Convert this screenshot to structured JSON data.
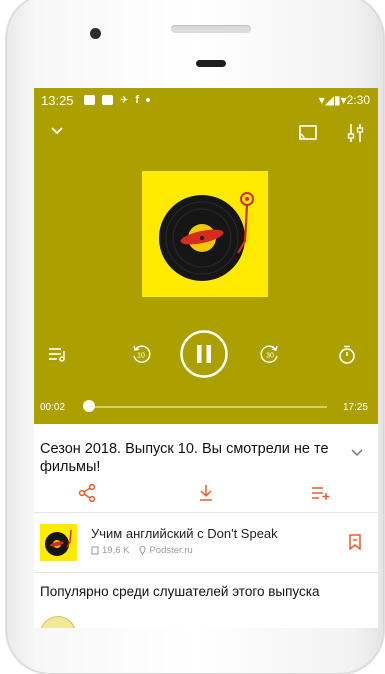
{
  "status_bar": {
    "time": "13:25",
    "fb": "f",
    "right": "▾◢▮▾2:30"
  },
  "player": {
    "elapsed": "00:02",
    "total": "17:25",
    "progress": 0.02,
    "background": "#aca000",
    "cover_text": "Don't Speak"
  },
  "episode": {
    "title": "Сезон 2018. Выпуск 10. Вы смотрели не те фильмы!"
  },
  "podcast": {
    "name": "Учим английский с Don't Speak",
    "listens": "19,6 K",
    "source": "Podster.ru"
  },
  "popular": {
    "title": "Популярно среди слушателей этого выпуска"
  },
  "colors": {
    "accent": "#f05a28",
    "cover_bg": "#ffea00"
  },
  "icons": [
    "chevron-down-icon",
    "cast-icon",
    "equalizer-icon",
    "playlist-icon",
    "rewind-10-icon",
    "pause-icon",
    "forward-30-icon",
    "timer-icon",
    "share-icon",
    "download-icon",
    "add-to-queue-icon",
    "bookmark-icon"
  ]
}
